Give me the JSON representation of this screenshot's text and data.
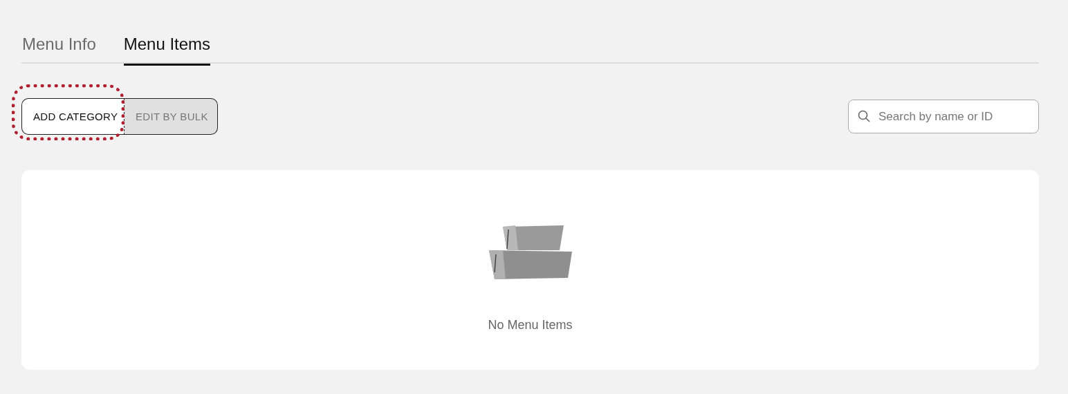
{
  "tabs": [
    {
      "label": "Menu Info",
      "selected": false
    },
    {
      "label": "Menu Items",
      "selected": true
    }
  ],
  "actions": [
    {
      "label": "ADD CATEGORY",
      "selected": true,
      "highlighted": true
    },
    {
      "label": "EDIT BY BULK",
      "selected": false,
      "highlighted": false
    }
  ],
  "search": {
    "placeholder": "Search by name or ID"
  },
  "empty_state": {
    "message": "No Menu Items"
  }
}
